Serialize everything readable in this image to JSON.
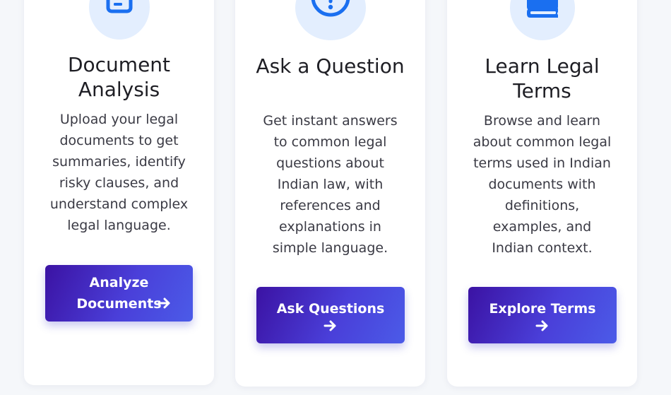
{
  "cards": [
    {
      "icon": "document-icon",
      "title": "Document Analysis",
      "description": "Upload your legal documents to get summaries, identify risky clauses, and understand complex legal language.",
      "button_label": "Analyze Documents"
    },
    {
      "icon": "question-icon",
      "title": "Ask a Question",
      "description": "Get instant answers to common legal questions about Indian law, with references and explanations in simple language.",
      "button_label": "Ask Questions"
    },
    {
      "icon": "book-icon",
      "title": "Learn Legal Terms",
      "description": "Browse and learn about common legal terms used in Indian documents with definitions, examples, and Indian context.",
      "button_label": "Explore Terms"
    }
  ],
  "colors": {
    "accent": "#1a6ff0",
    "icon_bg": "#e3eefe",
    "button_start": "#3b12a3",
    "button_end": "#4b5be8"
  }
}
